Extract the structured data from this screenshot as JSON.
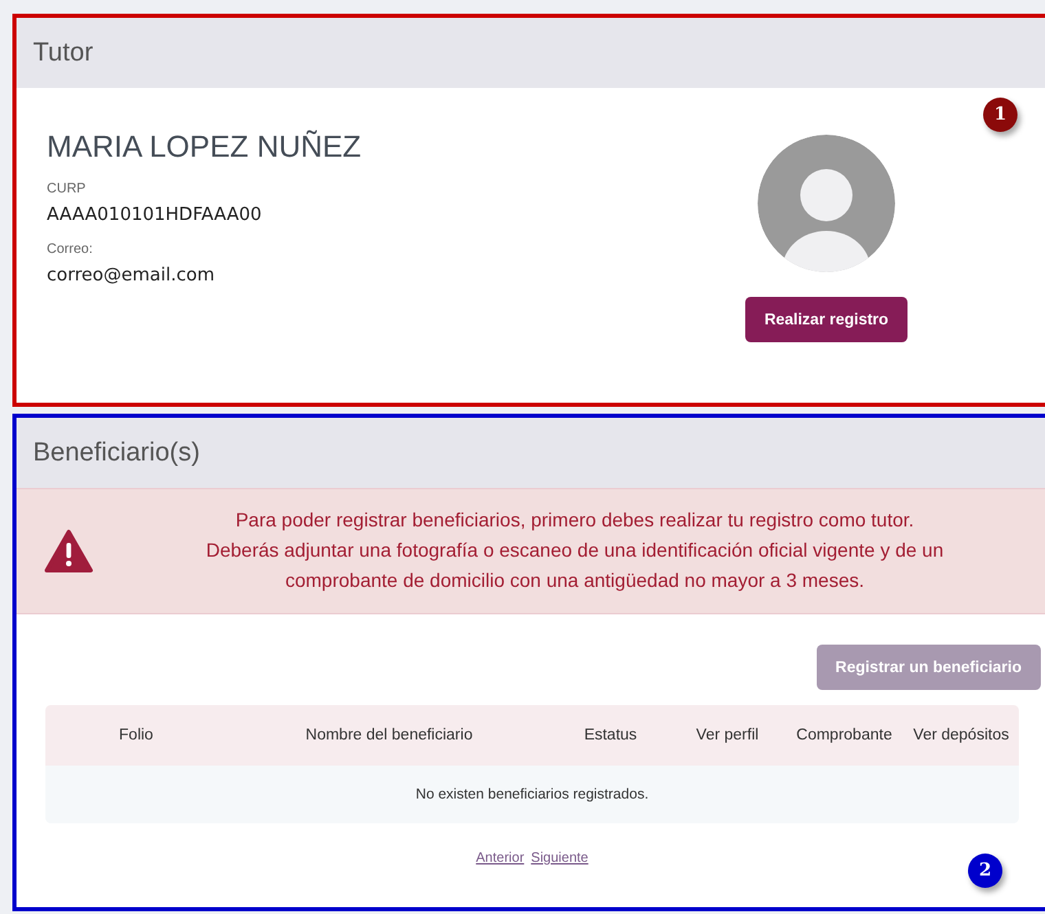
{
  "tutor": {
    "title": "Tutor",
    "color": "#cc0000",
    "marker": {
      "label": "1",
      "color": "#8b0a0a"
    },
    "name": "MARIA LOPEZ NUÑEZ",
    "fields": [
      {
        "label": "CURP",
        "value": "AAAA010101HDFAAA00"
      },
      {
        "label": "Correo:",
        "value": "correo@email.com"
      }
    ],
    "button": {
      "label": "Realizar registro",
      "disabled": false
    }
  },
  "beneficiaries": {
    "title": "Beneficiario(s)",
    "color": "#0000cc",
    "marker": {
      "label": "2",
      "color": "#0000cc"
    },
    "alert": {
      "lines": [
        "Para poder registrar beneficiarios, primero debes realizar tu registro como tutor.",
        "Deberás adjuntar una fotografía o escaneo de una identificación oficial vigente y de un",
        "comprobante de domicilio con una antigüedad no mayor a 3 meses."
      ]
    },
    "button": {
      "label": "Registrar un beneficiario",
      "disabled": true
    },
    "table": {
      "columns": [
        "Folio",
        "Nombre del beneficiario",
        "Estatus",
        "Ver perfil",
        "Comprobante",
        "Ver depósitos"
      ],
      "empty_message": "No existen beneficiarios registrados."
    },
    "pagination": [
      "Anterior",
      "Siguiente"
    ]
  }
}
